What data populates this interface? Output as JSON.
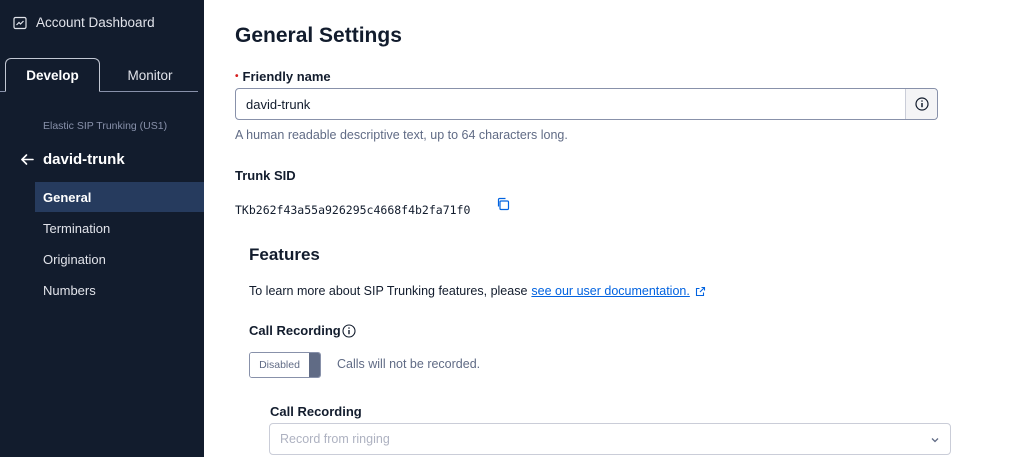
{
  "sidebar": {
    "account_label": "Account Dashboard",
    "tabs": [
      {
        "label": "Develop",
        "active": true
      },
      {
        "label": "Monitor",
        "active": false
      }
    ],
    "region_label": "Elastic SIP Trunking (US1)",
    "trunk_name": "david-trunk",
    "nav_items": [
      {
        "label": "General",
        "active": true
      },
      {
        "label": "Termination",
        "active": false
      },
      {
        "label": "Origination",
        "active": false
      },
      {
        "label": "Numbers",
        "active": false
      }
    ]
  },
  "main": {
    "title": "General Settings",
    "friendly_name": {
      "required_marker": "•",
      "label": "Friendly name",
      "value": "david-trunk",
      "help": "A human readable descriptive text, up to 64 characters long."
    },
    "trunk_sid": {
      "label": "Trunk SID",
      "value": "TKb262f43a55a926295c4668f4b2fa71f0"
    },
    "features": {
      "title": "Features",
      "learn_text": "To learn more about SIP Trunking features, please",
      "learn_link": "see our user documentation.",
      "call_recording": {
        "label": "Call Recording",
        "toggle_label": "Disabled",
        "toggle_desc": "Calls will not be recorded.",
        "select_label": "Call Recording",
        "select_value": "Record from ringing"
      }
    }
  },
  "colors": {
    "sidebar_bg": "#121c2d",
    "nav_active_bg": "#263b5e",
    "link": "#0263e0",
    "required": "#d61f1f"
  }
}
